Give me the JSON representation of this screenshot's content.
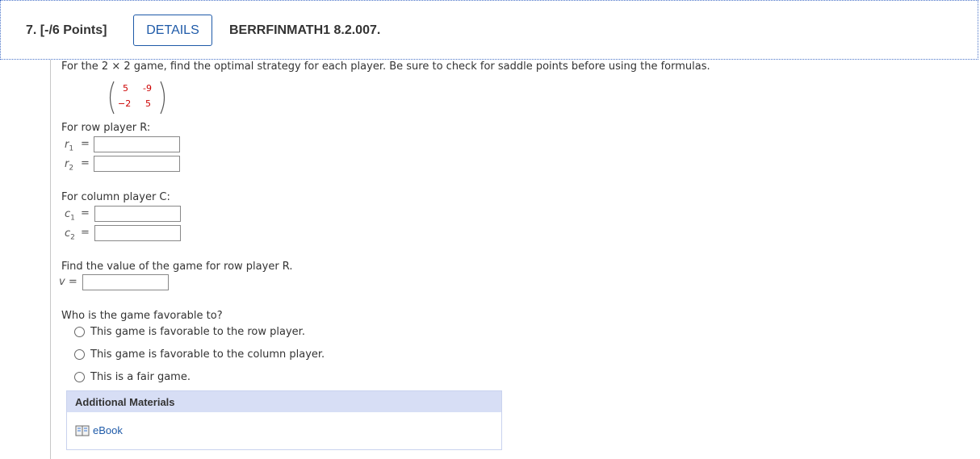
{
  "question": {
    "number_label": "7. [-/6 Points]",
    "details_label": "DETAILS",
    "code": "BERRFINMATH1 8.2.007.",
    "prompt": "For the 2 × 2 game, find the optimal strategy for each player. Be sure to check for saddle points before using the formulas."
  },
  "matrix": {
    "r1c1": "5",
    "r1c2": "-9",
    "r2c1": "−2",
    "r2c2": "5"
  },
  "row_player": {
    "label": "For row player R:",
    "r1_var": "r",
    "r1_sub": "1",
    "r2_var": "r",
    "r2_sub": "2",
    "eq": "=",
    "r1_value": "",
    "r2_value": ""
  },
  "column_player": {
    "label": "For column player C:",
    "c1_var": "c",
    "c1_sub": "1",
    "c2_var": "c",
    "c2_sub": "2",
    "eq": "=",
    "c1_value": "",
    "c2_value": ""
  },
  "value_section": {
    "label": "Find the value of the game for row player R.",
    "v_label": "v =",
    "v_value": ""
  },
  "favorable": {
    "question": "Who is the game favorable to?",
    "options": [
      "This game is favorable to the row player.",
      "This game is favorable to the column player.",
      "This is a fair game."
    ]
  },
  "additional": {
    "title": "Additional Materials",
    "ebook_label": "eBook"
  }
}
